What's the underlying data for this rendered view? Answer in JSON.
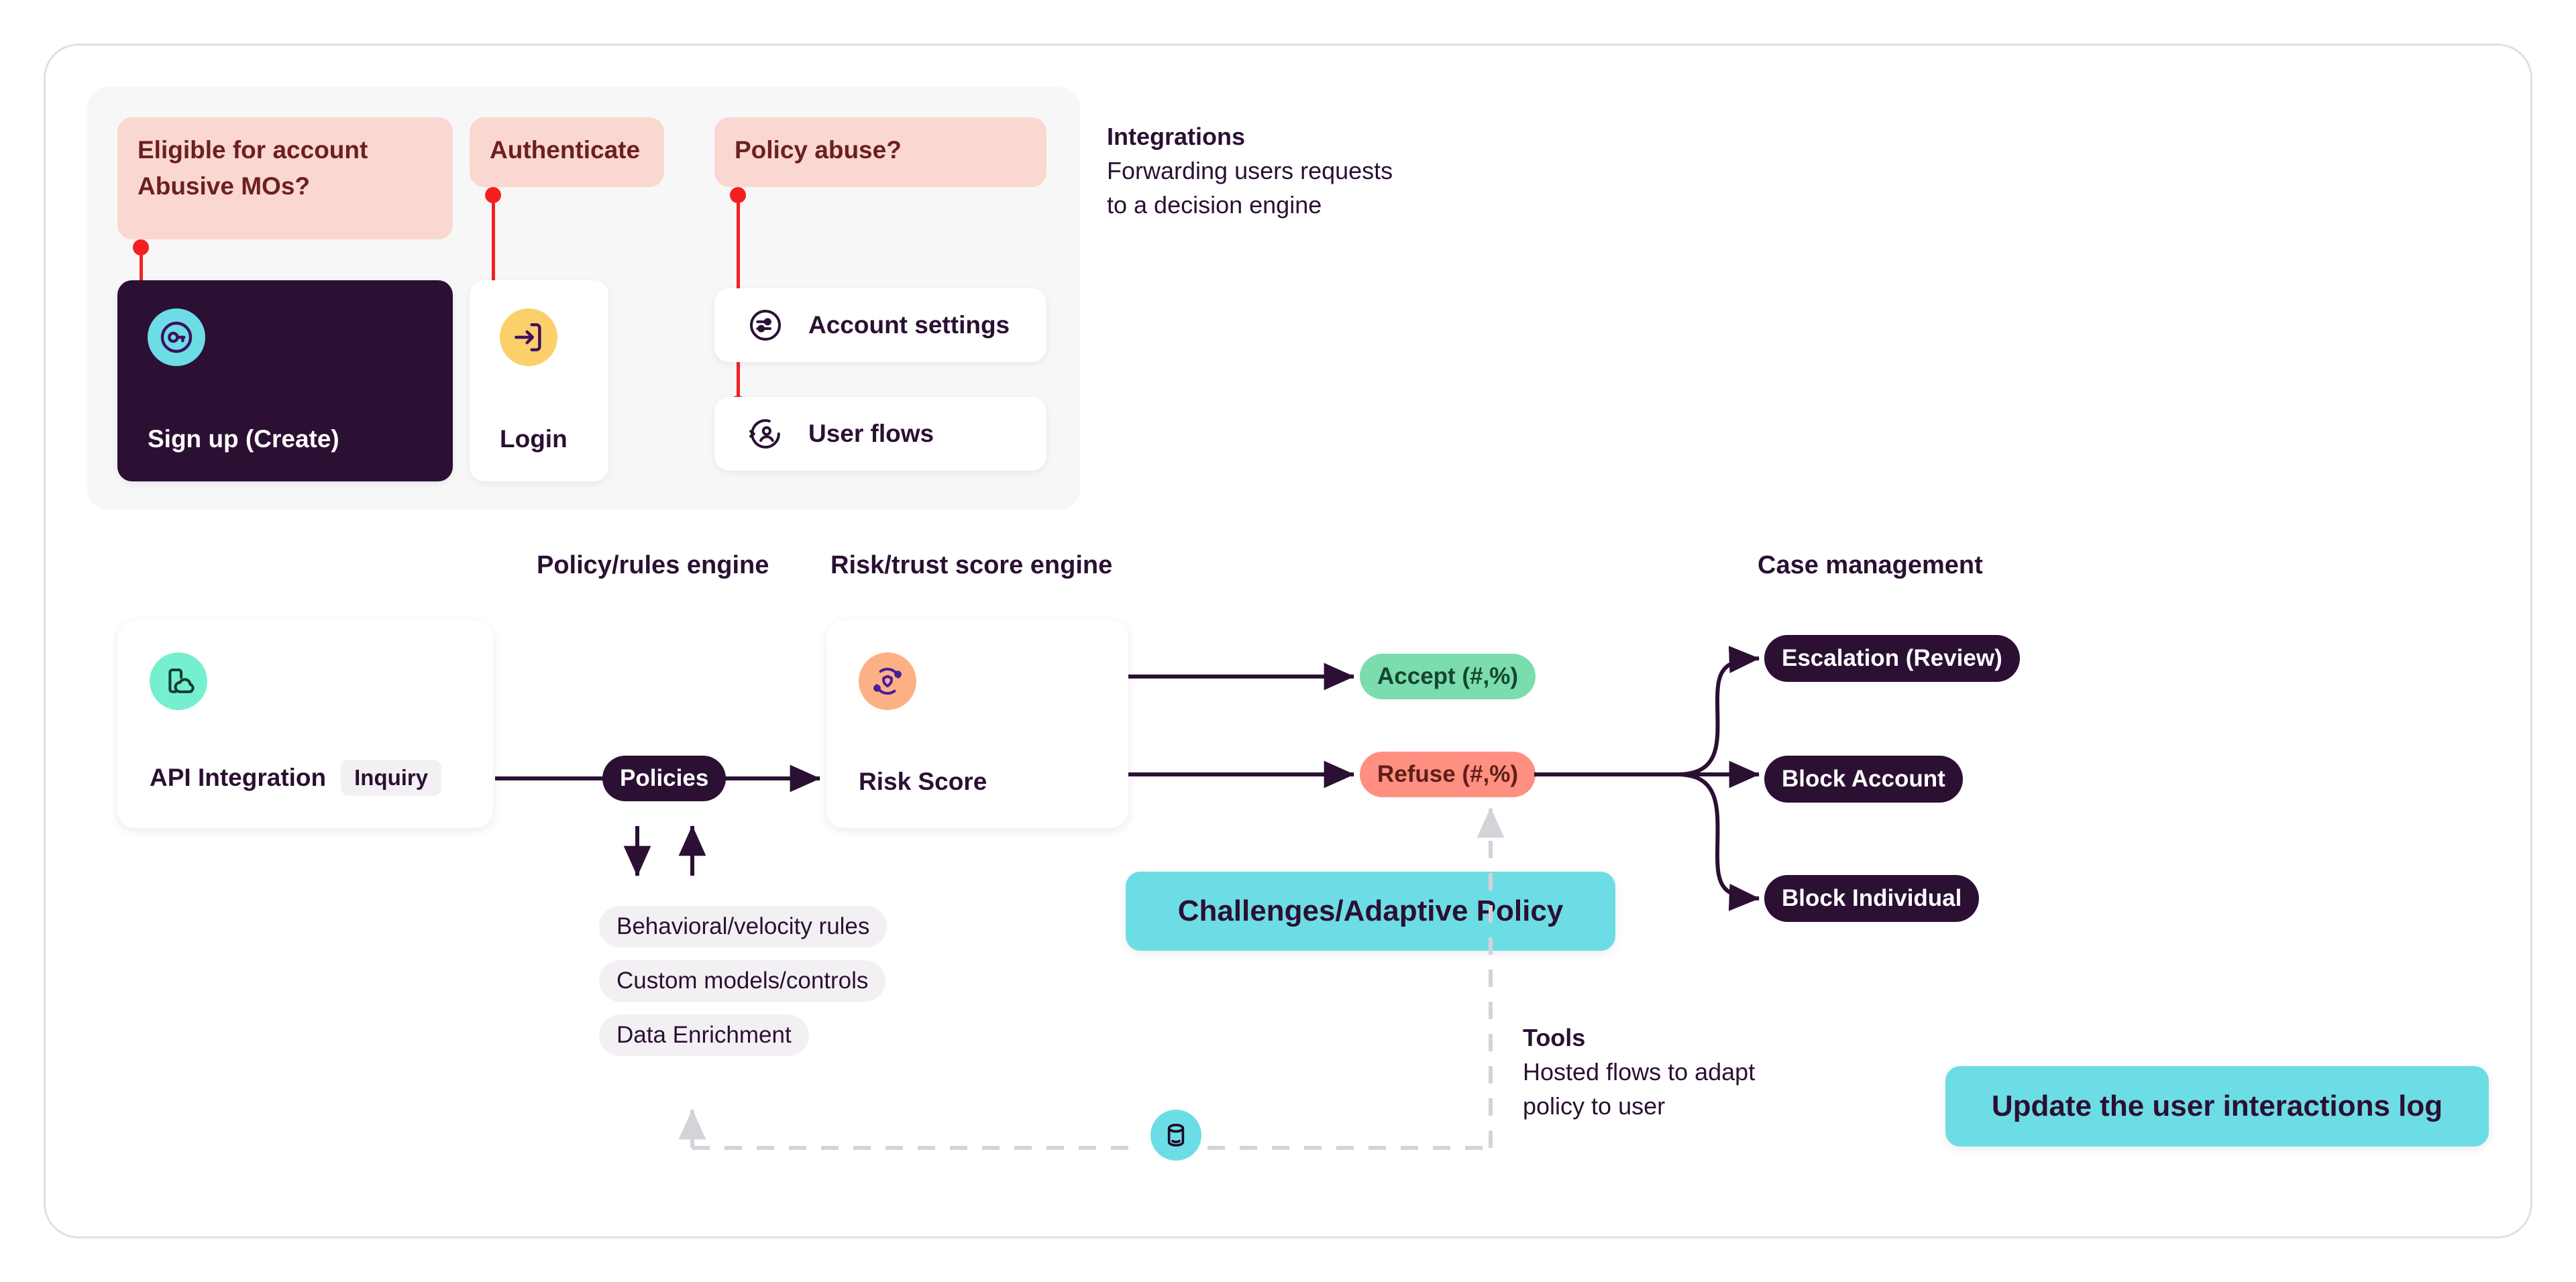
{
  "diagram": {
    "top_section": {
      "headers": [
        {
          "id": "eligible",
          "label": "Eligible for account\nAbusive MOs?"
        },
        {
          "id": "authenticate",
          "label": "Authenticate"
        },
        {
          "id": "policy_abuse",
          "label": "Policy abuse?"
        }
      ],
      "cards": [
        {
          "id": "signup",
          "label": "Sign up (Create)",
          "icon": "key-circle-icon",
          "icon_bg": "#6ddde5",
          "card_bg": "#2b1033"
        },
        {
          "id": "login",
          "label": "Login",
          "icon": "login-arrow-icon",
          "icon_bg": "#fbd06b",
          "card_bg": "#ffffff"
        },
        {
          "id": "account_settings",
          "label": "Account settings",
          "icon": "settings-sliders-icon",
          "card_bg": "#ffffff"
        },
        {
          "id": "user_flows",
          "label": "User flows",
          "icon": "user-flow-icon",
          "card_bg": "#ffffff"
        }
      ]
    },
    "integrations_note": {
      "title": "Integrations",
      "line1": "Forwarding users requests",
      "line2": "to a decision engine"
    },
    "tools_note": {
      "title": "Tools",
      "line1": "Hosted flows to adapt",
      "line2": "policy to user"
    },
    "section_labels": {
      "policy_engine": "Policy/rules engine",
      "risk_engine": "Risk/trust score engine",
      "case_management": "Case management"
    },
    "flow": {
      "api_card": {
        "label": "API Integration",
        "chip": "Inquiry",
        "icon": "api-cloud-icon",
        "icon_bg": "#74f0ce"
      },
      "policies_pill": "Policies",
      "risk_card": {
        "label": "Risk Score",
        "icon": "risk-target-icon",
        "icon_bg": "#fcb184"
      },
      "outcomes": [
        {
          "id": "accept",
          "label": "Accept (#,%)",
          "color": "#7bdcae"
        },
        {
          "id": "refuse",
          "label": "Refuse (#,%)",
          "color": "#ff8f81"
        }
      ],
      "case_actions": [
        {
          "id": "escalation",
          "label": "Escalation (Review)"
        },
        {
          "id": "block_account",
          "label": "Block Account"
        },
        {
          "id": "block_individual",
          "label": "Block Individual"
        }
      ]
    },
    "rule_chips": [
      "Behavioral/velocity rules",
      "Custom models/controls",
      "Data Enrichment"
    ],
    "challenges_box": "Challenges/Adaptive Policy",
    "update_log_box": "Update the user interactions log",
    "database_icon": "database-icon",
    "colors": {
      "dark_purple": "#2b1033",
      "teal": "#6ddde5",
      "red_connector": "#f42020",
      "header_pink": "#fbd7d1",
      "header_text": "#6b2020",
      "accept_green": "#7bdcae",
      "refuse_red": "#ff8f81",
      "chip_grey": "#f3f0f4",
      "panel_grey": "#f7f7f8",
      "frame_border": "#e3dde6"
    }
  }
}
